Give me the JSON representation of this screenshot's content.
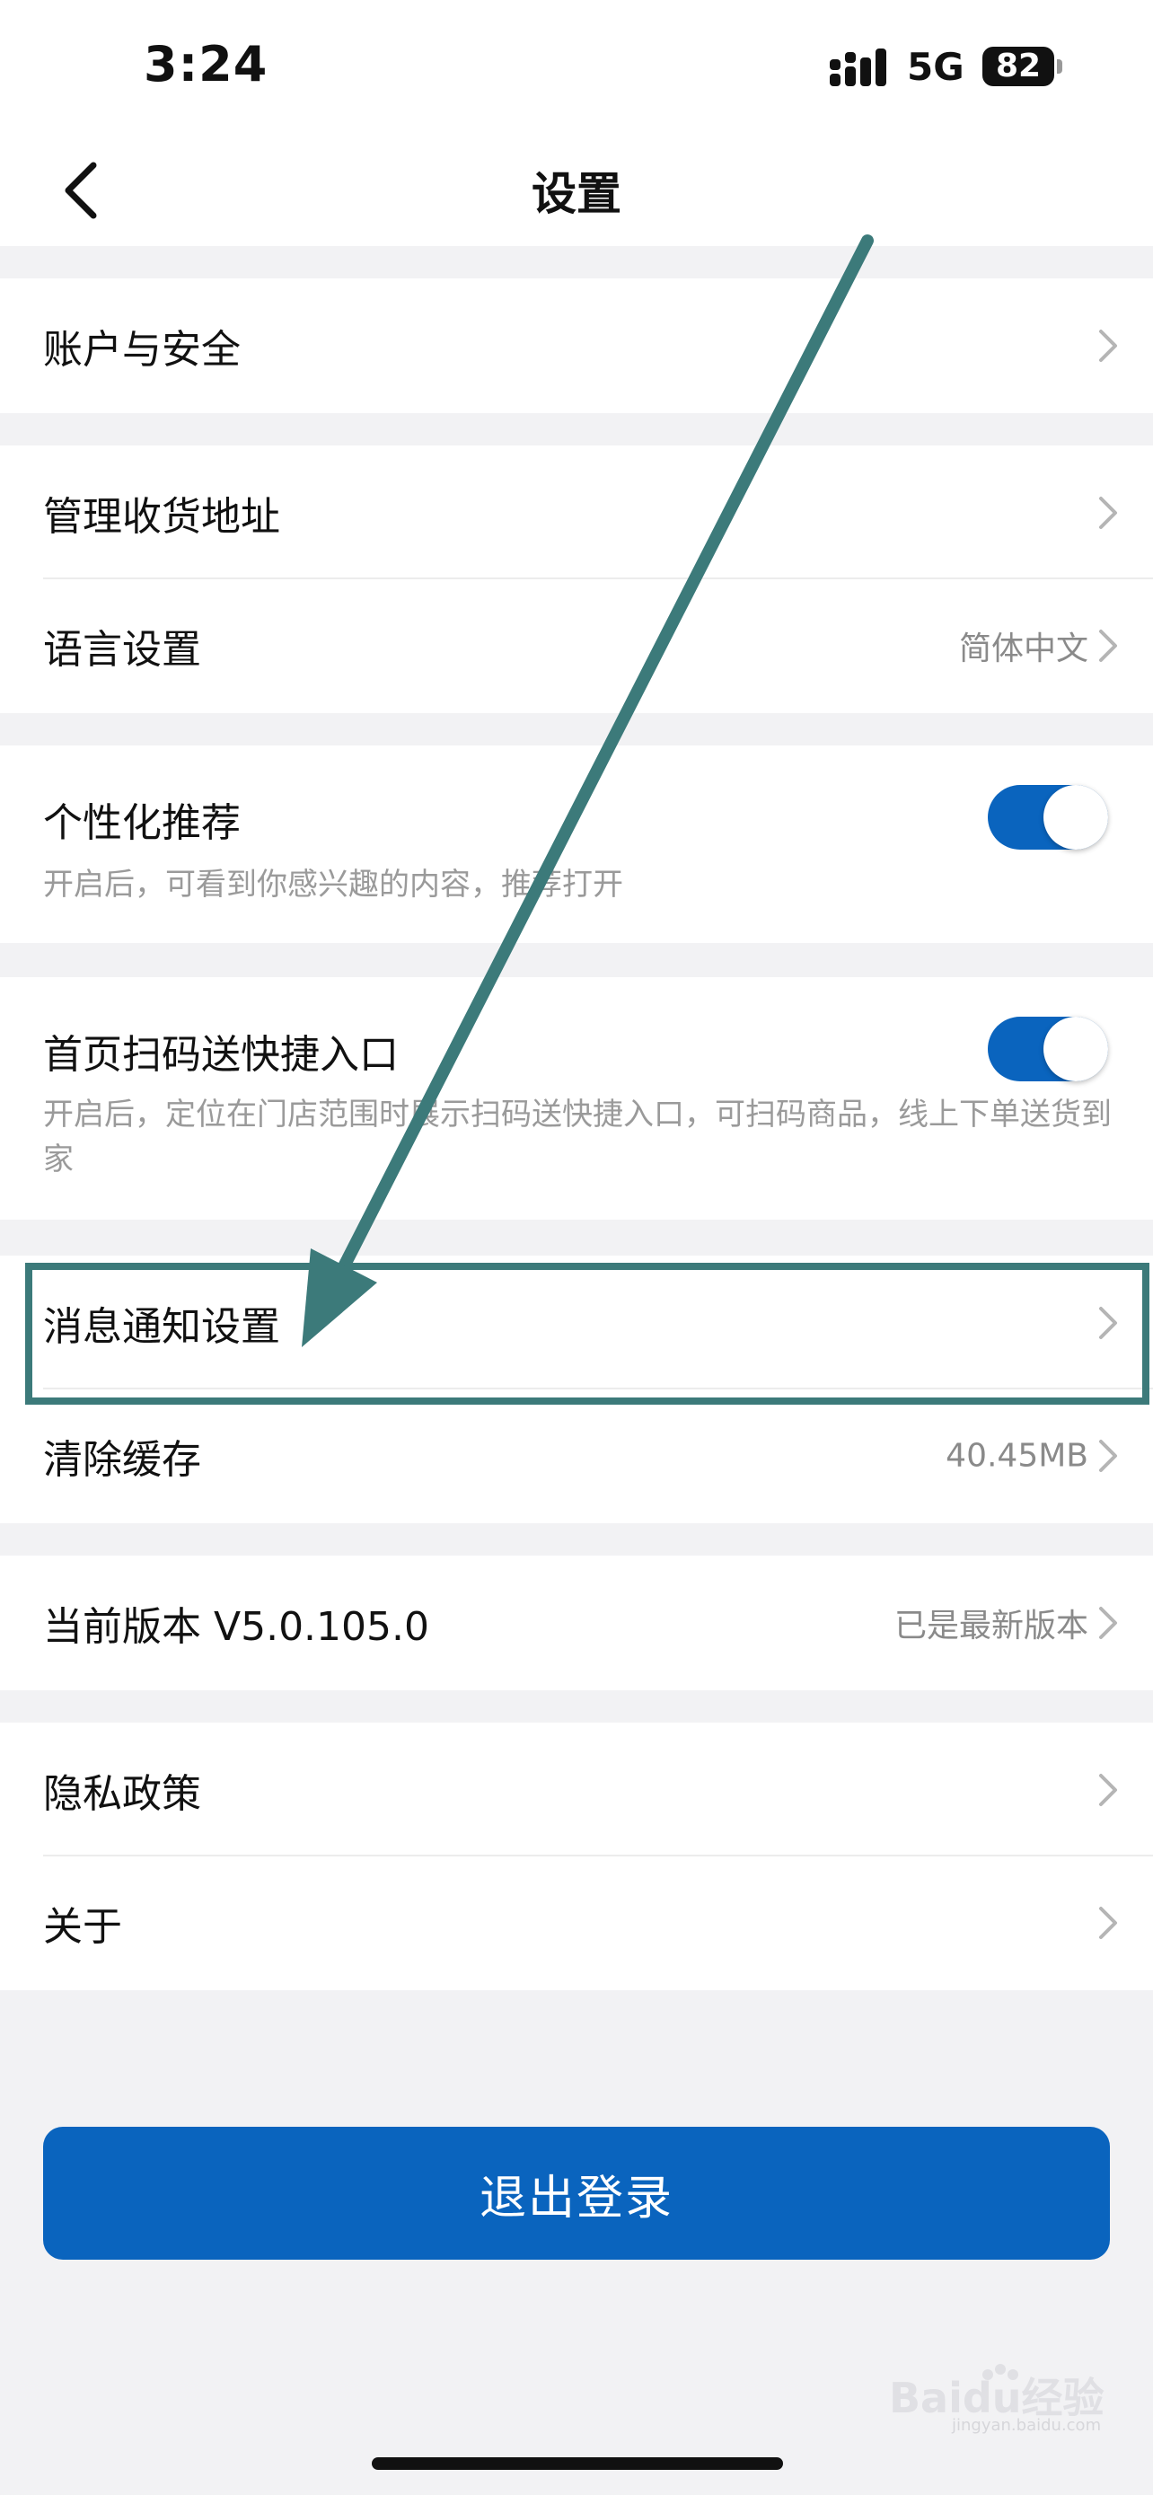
{
  "status_bar": {
    "time": "3:24",
    "network": "5G",
    "battery": "82"
  },
  "nav": {
    "title": "设置"
  },
  "sections": {
    "account": {
      "label": "账户与安全"
    },
    "address": {
      "label": "管理收货地址"
    },
    "language": {
      "label": "语言设置",
      "value": "简体中文"
    },
    "personalized": {
      "label": "个性化推荐",
      "desc": "开启后，可看到你感兴趣的内容，推荐打开",
      "enabled": true
    },
    "scan": {
      "label": "首页扫码送快捷入口",
      "desc": "开启后，定位在门店范围时展示扫码送快捷入口，可扫码商品，线上下单送货到家",
      "enabled": true
    },
    "notify": {
      "label": "消息通知设置"
    },
    "cache": {
      "label": "清除缓存",
      "value": "40.45MB"
    },
    "version": {
      "label": "当前版本 V5.0.105.0",
      "value": "已是最新版本"
    },
    "privacy": {
      "label": "隐私政策"
    },
    "about": {
      "label": "关于"
    }
  },
  "logout_label": "退出登录",
  "watermark": {
    "brand": "Baidu经验",
    "domain": "jingyan.baidu.com"
  },
  "colors": {
    "accent": "#0a64be",
    "highlight": "#3c7a7a",
    "background": "#f2f2f4"
  },
  "icons": [
    "back-arrow-icon",
    "signal-icon",
    "chevron-right-icon"
  ]
}
